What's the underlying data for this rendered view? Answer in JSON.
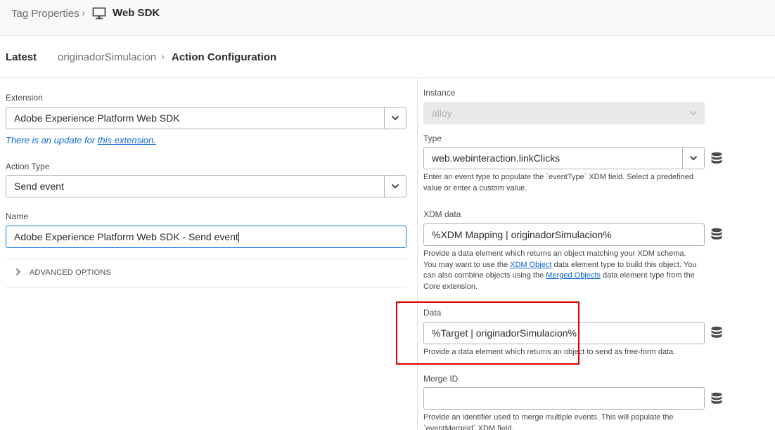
{
  "header": {
    "breadcrumb_parent": "Tag Properties",
    "breadcrumb_separator": "›",
    "property_name": "Web SDK",
    "monitor_icon": "monitor-icon"
  },
  "subheader": {
    "version": "Latest",
    "rule_name": "originadorSimulacion",
    "separator": "›",
    "page_title": "Action Configuration"
  },
  "left": {
    "extension_label": "Extension",
    "extension_value": "Adobe Experience Platform Web SDK",
    "update_notice_prefix": "There is an update for ",
    "update_notice_link": "this extension.",
    "action_type_label": "Action Type",
    "action_type_value": "Send event",
    "name_label": "Name",
    "name_value": "Adobe Experience Platform Web SDK - Send event",
    "advanced_label": "ADVANCED OPTIONS"
  },
  "right": {
    "instance_label": "Instance",
    "instance_value": "alloy",
    "type_label": "Type",
    "type_value": "web.webinteraction.linkClicks",
    "type_help": "Enter an event type to populate the `eventType` XDM field. Select a predefined value or enter a custom value.",
    "xdm_label": "XDM data",
    "xdm_value": "%XDM Mapping | originadorSimulacion%",
    "xdm_help_1": "Provide a data element which returns an object matching your XDM schema.",
    "xdm_help_2a": "You may want to use the ",
    "xdm_help_link1": "XDM Object",
    "xdm_help_2b": " data element type to build this object. You can also combine objects using the ",
    "xdm_help_link2": "Merged Objects",
    "xdm_help_2c": " data element type from the Core extension.",
    "data_label": "Data",
    "data_value": "%Target | originadorSimulacion%",
    "data_help": "Provide a data element which returns an object to send as free-form data.",
    "merge_label": "Merge ID",
    "merge_value": "",
    "merge_help": "Provide an identifier used to merge multiple events. This will populate the `eventMergeId` XDM field."
  },
  "colors": {
    "accent": "#1473e6",
    "link": "#0d66d0",
    "highlight_box": "#e00000"
  }
}
